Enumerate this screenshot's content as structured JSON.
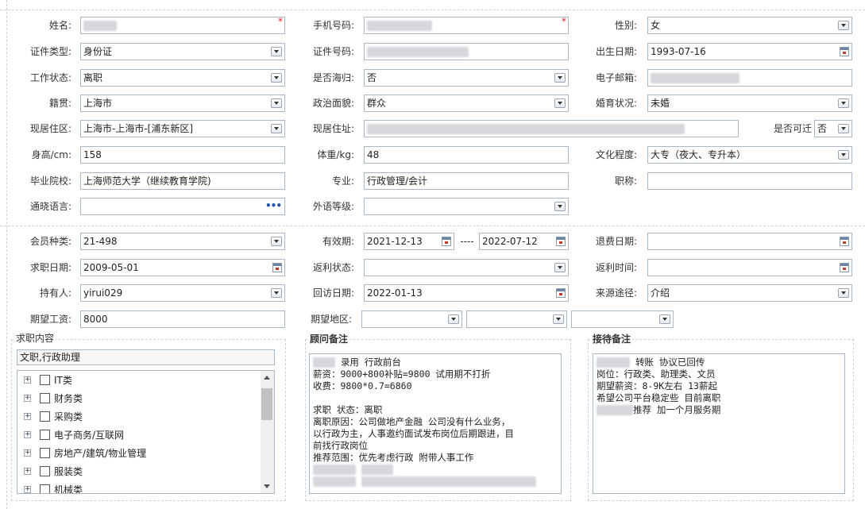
{
  "basic": {
    "name_label": "姓名:",
    "name_required": "*",
    "phone_label": "手机号码:",
    "phone_required": "*",
    "gender_label": "性别:",
    "gender_value": "女",
    "id_type_label": "证件类型:",
    "id_type_value": "身份证",
    "id_number_label": "证件号码:",
    "birth_label": "出生日期:",
    "birth_value": "1993-07-16",
    "work_status_label": "工作状态:",
    "work_status_value": "离职",
    "returnee_label": "是否海归:",
    "returnee_value": "否",
    "email_label": "电子邮箱:",
    "native_label": "籍贯:",
    "native_value": "上海市",
    "political_label": "政治面貌:",
    "political_value": "群众",
    "marital_label": "婚育状况:",
    "marital_value": "未婚",
    "residence_area_label": "现居住区:",
    "residence_area_value": "上海市-上海市-[浦东新区]",
    "address_label": "现居住址:",
    "relocate_label": "是否可迁",
    "relocate_value": "否",
    "height_label": "身高/cm:",
    "height_value": "158",
    "weight_label": "体重/kg:",
    "weight_value": "48",
    "education_label": "文化程度:",
    "education_value": "大专（夜大、专升本）",
    "school_label": "毕业院校:",
    "school_value": "上海师范大学（继续教育学院)",
    "major_label": "专业:",
    "major_value": "行政管理/会计",
    "title_label": "职称:",
    "language_label": "通晓语言:",
    "foreign_level_label": "外语等级:"
  },
  "membership": {
    "member_type_label": "会员种类:",
    "member_type_value": "21-498",
    "validity_label": "有效期:",
    "validity_from": "2021-12-13",
    "validity_sep": "----",
    "validity_to": "2022-07-12",
    "refund_date_label": "退费日期:",
    "job_date_label": "求职日期:",
    "job_date_value": "2009-05-01",
    "rebate_status_label": "返利状态:",
    "rebate_time_label": "返利时间:",
    "holder_label": "持有人:",
    "holder_value": "yirui029",
    "visit_date_label": "回访日期:",
    "visit_date_value": "2022-01-13",
    "source_label": "来源途径:",
    "source_value": "介绍",
    "salary_label": "期望工资:",
    "salary_value": "8000",
    "region_label": "期望地区:"
  },
  "job_content": {
    "title": "求职内容",
    "selected": "文职,行政助理",
    "categories": [
      "IT类",
      "财务类",
      "采购类",
      "电子商务/互联网",
      "房地产/建筑/物业管理",
      "服装类",
      "机械类"
    ]
  },
  "consultant_notes": {
    "title": "顾问备注",
    "lines": [
      "录用  行政前台",
      "薪资：9000+800补贴=9800  试用期不打折",
      "收费：9800*0.7=6860",
      "",
      "求职 状态：离职",
      "离职原因：公司做地产金融 公司没有什么业务，",
      "以行政为主，人事邀约面试发布岗位后期跟进，目",
      "前找行政岗位",
      "推荐范围：优先考虑行政 附带人事工作"
    ]
  },
  "reception_notes": {
    "title": "接待备注",
    "lines": [
      "转账 协议已回传",
      "岗位：行政类、助理类、文员",
      "期望薪资：8-9K左右  13薪起",
      "希望公司平台稳定些    目前离职",
      "推荐  加一个月服务期"
    ]
  },
  "colors": {
    "border": "#a9b8c8",
    "required": "#e02020",
    "dashed": "#c9d3de"
  }
}
